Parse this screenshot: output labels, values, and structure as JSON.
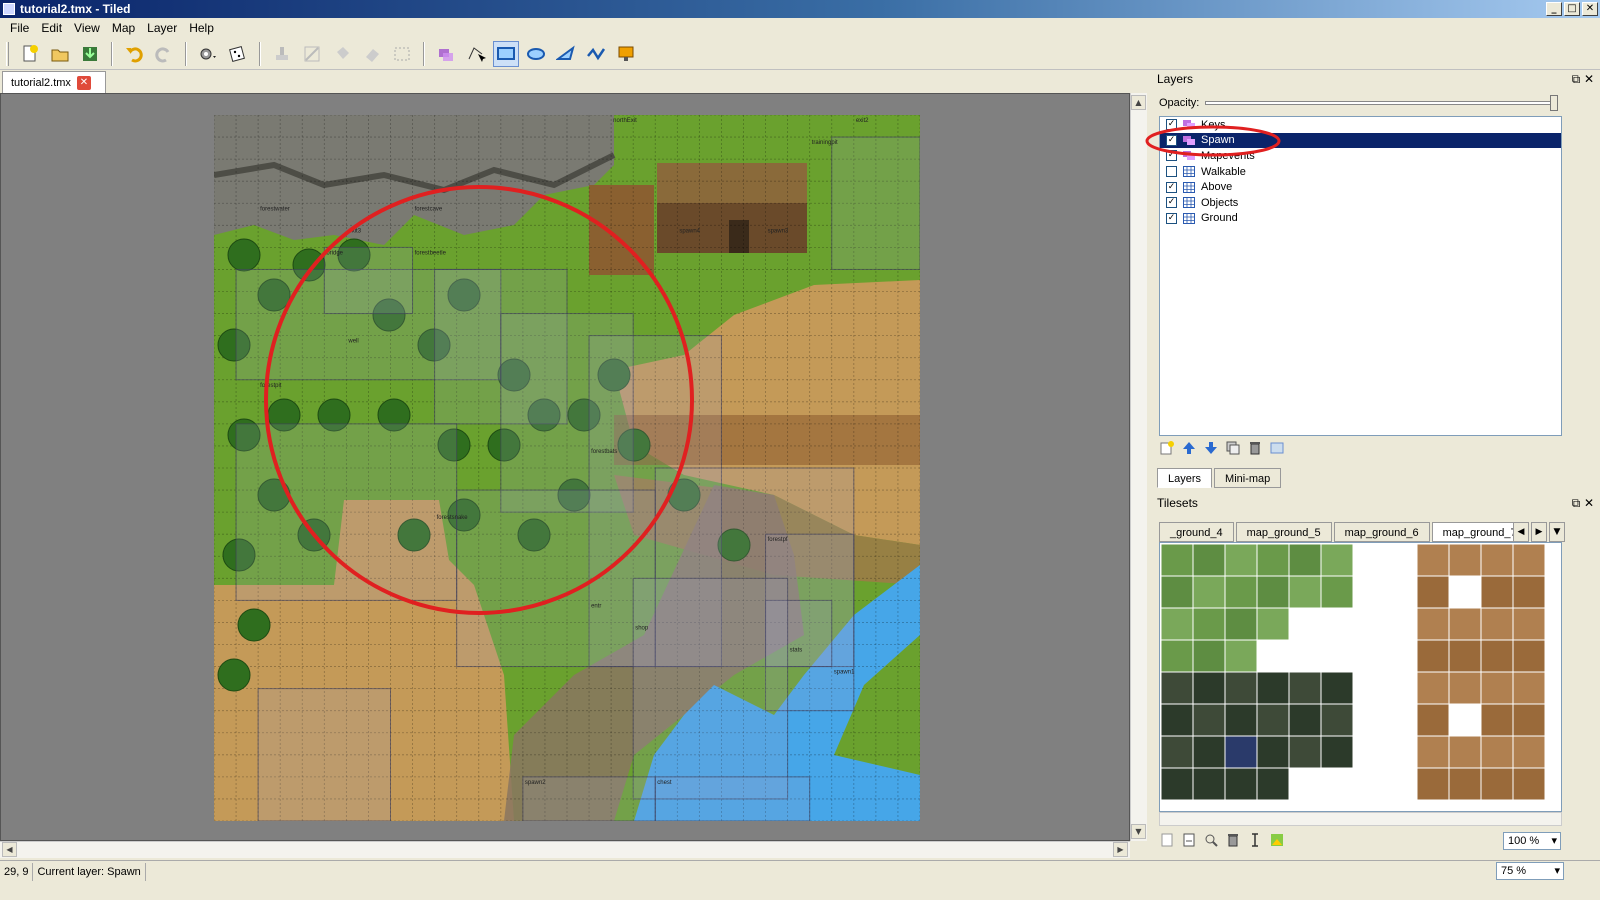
{
  "window": {
    "title": "tutorial2.tmx - Tiled"
  },
  "window_controls": [
    "_",
    "□",
    "✕"
  ],
  "menu": [
    "File",
    "Edit",
    "View",
    "Map",
    "Layer",
    "Help"
  ],
  "document_tab": {
    "label": "tutorial2.tmx",
    "close": "✕"
  },
  "layers_panel": {
    "title": "Layers",
    "opacity_label": "Opacity:",
    "opacity": 1.0,
    "layers": [
      {
        "name": "Keys",
        "visible": true,
        "type": "object"
      },
      {
        "name": "Spawn",
        "visible": true,
        "type": "object",
        "selected": true
      },
      {
        "name": "Mapevents",
        "visible": true,
        "type": "object"
      },
      {
        "name": "Walkable",
        "visible": false,
        "type": "tile"
      },
      {
        "name": "Above",
        "visible": true,
        "type": "tile"
      },
      {
        "name": "Objects",
        "visible": true,
        "type": "tile"
      },
      {
        "name": "Ground",
        "visible": true,
        "type": "tile"
      }
    ],
    "tabs": [
      "Layers",
      "Mini-map"
    ]
  },
  "tilesets_panel": {
    "title": "Tilesets",
    "tabs": [
      "_ground_4",
      "map_ground_5",
      "map_ground_6",
      "map_ground_7"
    ],
    "selected_tab": "map_ground_7",
    "zoom": "100 %"
  },
  "map_objects": [
    "northExit",
    "exit2",
    "trainingpit",
    "forestwater",
    "forestcave",
    "forestbeetle",
    "forestpit",
    "forestbats",
    "forestsnake",
    "forestpf",
    "spawn1",
    "spawn2",
    "chest",
    "shop",
    "stats",
    "entr",
    "spawn3",
    "spawn4",
    "exit3",
    "bridge",
    "well"
  ],
  "status": {
    "coords": "29, 9",
    "current_layer": "Current layer: Spawn",
    "zoom": "75 %"
  },
  "colors": {
    "selection": "#0a246a",
    "annotation": "#e02020",
    "canvas_bg": "#808080"
  }
}
